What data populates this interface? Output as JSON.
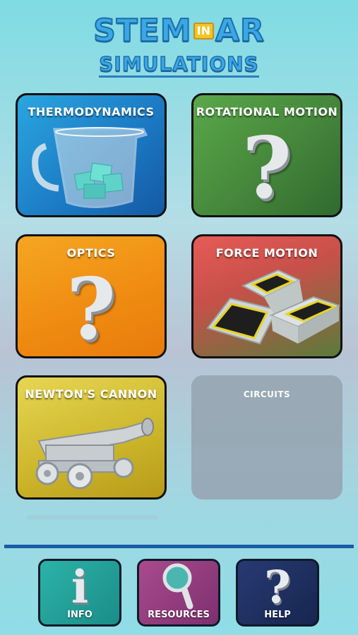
{
  "logo": {
    "word_left": "STEM",
    "word_in": "IN",
    "word_right": "AR",
    "subtitle": "SIMULATIONS"
  },
  "tiles": [
    {
      "title": "THERMODYNAMICS",
      "icon": "ice-pitcher-icon",
      "color": "#1b78c2"
    },
    {
      "title": "ROTATIONAL MOTION",
      "icon": "question-mark-icon",
      "color": "#3f7d37"
    },
    {
      "title": "OPTICS",
      "icon": "question-mark-icon",
      "color": "#ef8a10"
    },
    {
      "title": "FORCE MOTION",
      "icon": "sled-block-icon",
      "color": "#c8504a"
    },
    {
      "title": "NEWTON'S CANNON",
      "icon": "cannon-icon",
      "color": "#cbb52a"
    },
    {
      "title": "CIRCUITS",
      "icon": "none",
      "color": "#98a8b5"
    }
  ],
  "question_glyph": "?",
  "bottom_nav": [
    {
      "label": "INFO",
      "icon": "info-icon",
      "glyph": "i",
      "color": "#1a8d88"
    },
    {
      "label": "RESOURCES",
      "icon": "magnifier-icon",
      "color": "#7d2f6f"
    },
    {
      "label": "HELP",
      "icon": "help-icon",
      "glyph": "?",
      "color": "#172650"
    }
  ],
  "divider_color": "#1a5ca8"
}
